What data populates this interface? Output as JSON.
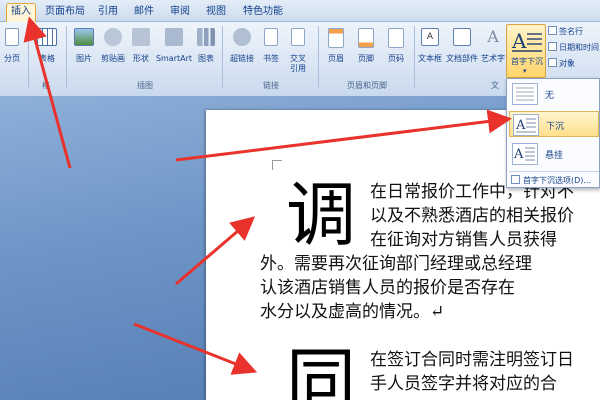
{
  "tabs": [
    {
      "label": "插入",
      "active": true
    },
    {
      "label": "页面布局"
    },
    {
      "label": "引用"
    },
    {
      "label": "邮件"
    },
    {
      "label": "审阅"
    },
    {
      "label": "视图"
    },
    {
      "label": "特色功能"
    }
  ],
  "ribbon": {
    "page_break": "分页",
    "table": "表格",
    "table_group": "格",
    "picture": "图片",
    "clipart": "剪贴画",
    "shapes": "形状",
    "smartart": "SmartArt",
    "chart": "图表",
    "illustrations_group": "插图",
    "hyperlink": "超链接",
    "bookmark": "书签",
    "crossref": "交叉引用",
    "links_group": "链接",
    "header": "页眉",
    "footer": "页脚",
    "pagenum": "页码",
    "header_footer_group": "页眉和页脚",
    "textbox": "文本框",
    "quickparts": "文档部件",
    "wordart": "艺术字",
    "dropcap": "首字下沉",
    "text_group": "文",
    "signature": "签名行",
    "datetime": "日期和时间",
    "object": "对象"
  },
  "dropdown": {
    "none": "无",
    "dropped": "下沉",
    "margin": "悬挂",
    "options": "首字下沉选项(D)..."
  },
  "document": {
    "para1_cap": "调",
    "para1_lines": [
      "在日常报价工作中，针对不",
      "以及不熟悉酒店的相关报价",
      "在征询对方销售人员获得",
      "外。需要再次征询部门经理或总经理",
      "认该酒店销售人员的报价是否存在",
      "水分以及虚高的情况。↵"
    ],
    "para2_cap": "同",
    "para2_lines": [
      "在签订合同时需注明签订日",
      "手人员签字并将对应的合"
    ]
  },
  "colors": {
    "ribbon_text": "#15428b",
    "highlight": "#ffd56b",
    "arrow": "#e8322b"
  }
}
